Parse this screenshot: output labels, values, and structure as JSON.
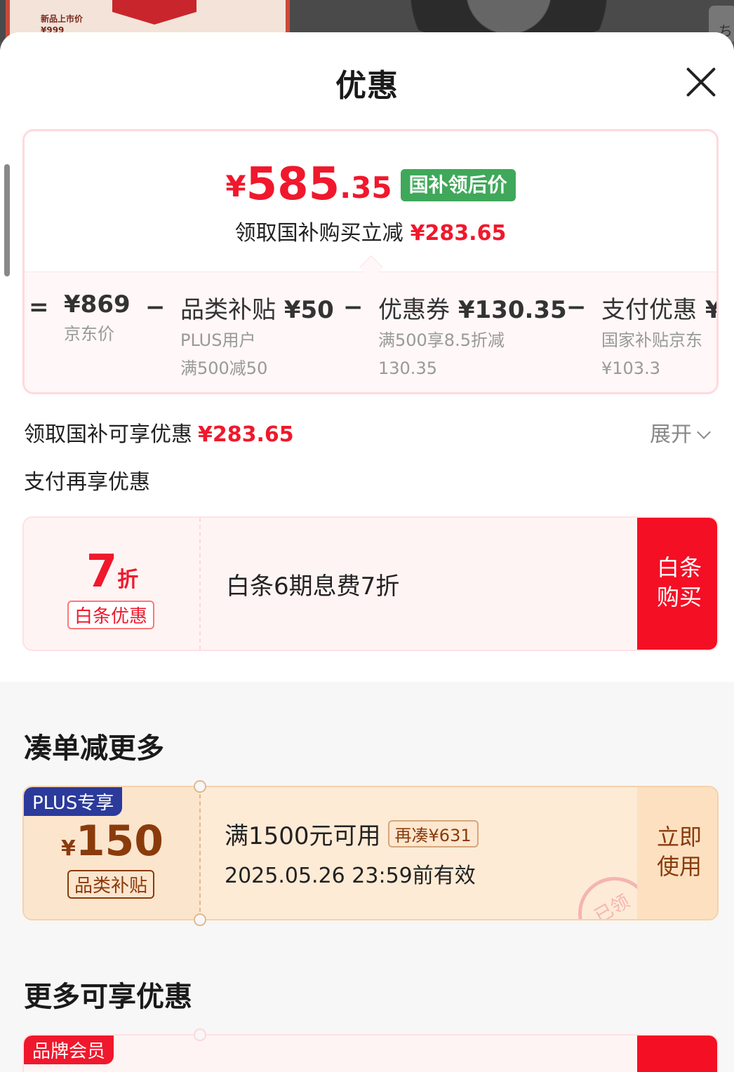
{
  "backdrop": {
    "promo_line1": "新品上市价",
    "promo_line2": "¥999"
  },
  "sheet": {
    "title": "优惠"
  },
  "price_card": {
    "currency": "¥",
    "price_int": "585",
    "price_dec": ".35",
    "tag": "国补领后价",
    "sub_text": "领取国补购买立减",
    "sub_amount": "¥283.65",
    "breakdown": {
      "eq": "=",
      "minus": "−",
      "items": [
        {
          "main": "¥869",
          "sub1": "京东价",
          "sub2": ""
        },
        {
          "label": "品类补贴",
          "amount": "¥50",
          "sub1": "PLUS用户",
          "sub2": "满500减50"
        },
        {
          "label": "优惠券",
          "amount": "¥130.35",
          "sub1": "满500享8.5折减",
          "sub2": "130.35"
        },
        {
          "label": "支付优惠",
          "amount": "¥",
          "sub1": "国家补贴京东",
          "sub2": "¥103.3"
        }
      ]
    }
  },
  "guobu_row": {
    "label": "领取国补可享优惠",
    "amount": "¥283.65",
    "expand": "展开"
  },
  "pay_row": {
    "label": "支付再享优惠"
  },
  "baitiao": {
    "discount": "7",
    "unit": "折",
    "badge": "白条优惠",
    "desc": "白条6期息费7折",
    "button_line1": "白条",
    "button_line2": "购买"
  },
  "bundle_section": {
    "title": "凑单减更多"
  },
  "coupon": {
    "tag": "PLUS专享",
    "currency": "¥",
    "amount": "150",
    "badge": "品类补贴",
    "condition": "满1500元可用",
    "more": "再凑¥631",
    "valid": "2025.05.26 23:59前有效",
    "button_line1": "立即",
    "button_line2": "使用",
    "stamp": "已领"
  },
  "more_section": {
    "title": "更多可享优惠"
  },
  "brand_card": {
    "tag": "品牌会员"
  },
  "colors": {
    "accent_red": "#f0182c",
    "green_tag": "#3fa85a",
    "plus_blue": "#2b3a9b",
    "coupon_brown": "#8a3b0c"
  }
}
